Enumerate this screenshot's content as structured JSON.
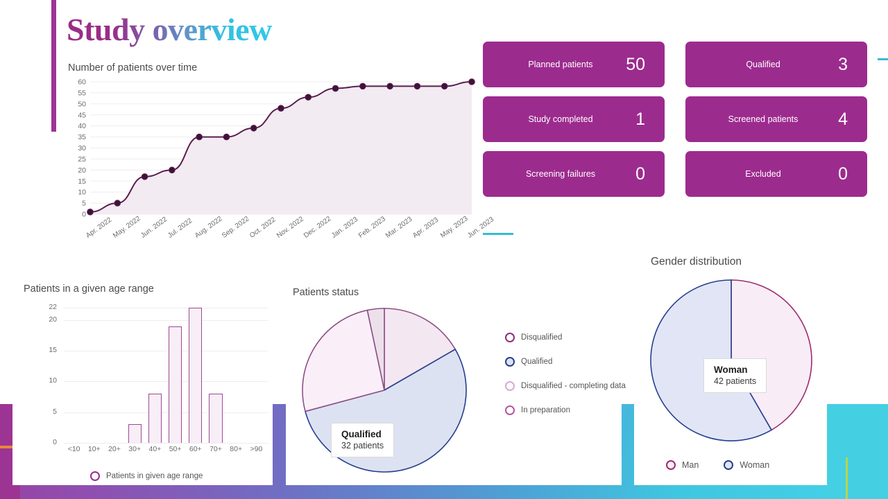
{
  "header": {
    "title": "Study overview"
  },
  "colors": {
    "brand_purple": "#9c2b8e",
    "accent_cyan": "#3bb8d4",
    "accent_orange": "#e8883c",
    "accent_yellow": "#b9d44a",
    "line_series": "#5b1d4e",
    "pie_blue": "#243f8f",
    "pie_pink": "#f6eaf4"
  },
  "kpis": [
    {
      "label": "Planned patients",
      "value": "50"
    },
    {
      "label": "Qualified",
      "value": "3"
    },
    {
      "label": "Study completed",
      "value": "1"
    },
    {
      "label": "Screened patients",
      "value": "4"
    },
    {
      "label": "Screening failures",
      "value": "0"
    },
    {
      "label": "Excluded",
      "value": "0"
    }
  ],
  "chart_data": [
    {
      "type": "line",
      "title": "Number of patients over time",
      "xlabel": "",
      "ylabel": "",
      "ylim": [
        0,
        60
      ],
      "yticks": [
        0,
        5,
        10,
        15,
        20,
        25,
        30,
        35,
        40,
        45,
        50,
        55,
        60
      ],
      "grid": true,
      "categories": [
        "Apr. 2022",
        "May. 2022",
        "Jun. 2022",
        "Jul. 2022",
        "Aug. 2022",
        "Sep. 2022",
        "Oct. 2022",
        "Nov. 2022",
        "Dec. 2022",
        "Jan. 2023",
        "Feb. 2023",
        "Mar. 2023",
        "Apr. 2023",
        "May. 2023",
        "Jun. 2023"
      ],
      "values": [
        1,
        5,
        17,
        20,
        35,
        35,
        39,
        48,
        53,
        57,
        58,
        58,
        58,
        58,
        60
      ],
      "area_fill": true,
      "legend": []
    },
    {
      "type": "bar",
      "title": "Patients in a given age range",
      "xlabel": "",
      "ylabel": "",
      "ylim": [
        0,
        22
      ],
      "yticks": [
        0,
        5,
        10,
        15,
        20,
        22
      ],
      "grid": true,
      "categories": [
        "<10",
        "10+",
        "20+",
        "30+",
        "40+",
        "50+",
        "60+",
        "70+",
        "80+",
        ">90"
      ],
      "values": [
        0,
        0,
        0,
        3,
        8,
        19,
        22,
        8,
        0,
        0
      ],
      "legend": [
        "Patients in given age range"
      ]
    },
    {
      "type": "pie",
      "title": "Patients status",
      "legend_position": "right",
      "labels": [
        "Disqualified",
        "Qualified",
        "Disqualified - completing data",
        "In preparation"
      ],
      "slices": [
        {
          "label": "In preparation",
          "degrees": 60,
          "color": "#f3e7f1"
        },
        {
          "label": "Qualified",
          "degrees": 195,
          "color": "#dde2f2",
          "value": 32,
          "value_label": "32 patients"
        },
        {
          "label": "Disqualified - completing data",
          "degrees": 93,
          "color": "#faeff8"
        },
        {
          "label": "Disqualified",
          "degrees": 12,
          "color": "#ece0ea"
        }
      ],
      "callout": {
        "title": "Qualified",
        "subtitle": "32 patients"
      }
    },
    {
      "type": "pie",
      "title": "Gender distribution",
      "legend_position": "bottom",
      "labels": [
        "Man",
        "Woman"
      ],
      "slices": [
        {
          "label": "Man",
          "degrees": 150,
          "color": "#f8ecf6"
        },
        {
          "label": "Woman",
          "degrees": 210,
          "color": "#e2e5f5",
          "value": 42,
          "value_label": "42 patients"
        }
      ],
      "callout": {
        "title": "Woman",
        "subtitle": "42 patients"
      }
    }
  ]
}
